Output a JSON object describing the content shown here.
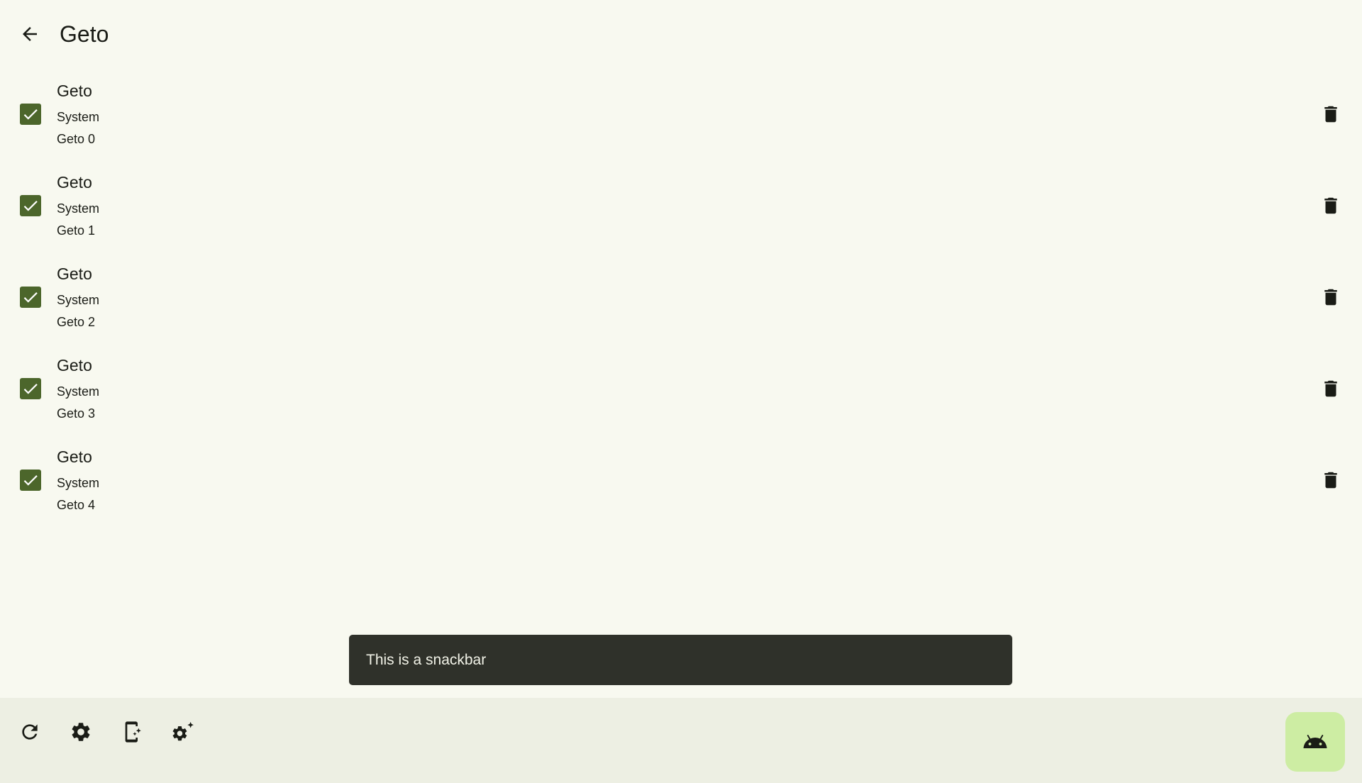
{
  "app": {
    "title": "Geto"
  },
  "topbar": {
    "back_icon": "arrow-back-icon"
  },
  "items": [
    {
      "title": "Geto",
      "subtitle": "System",
      "value": "Geto 0",
      "checked": true
    },
    {
      "title": "Geto",
      "subtitle": "System",
      "value": "Geto 1",
      "checked": true
    },
    {
      "title": "Geto",
      "subtitle": "System",
      "value": "Geto 2",
      "checked": true
    },
    {
      "title": "Geto",
      "subtitle": "System",
      "value": "Geto 3",
      "checked": true
    },
    {
      "title": "Geto",
      "subtitle": "System",
      "value": "Geto 4",
      "checked": true
    }
  ],
  "snackbar": {
    "message": "This is a snackbar"
  },
  "bottombar": {
    "actions": [
      "refresh-icon",
      "settings-icon",
      "app-settings-icon",
      "auto-settings-icon"
    ],
    "fab_icon": "android-icon"
  },
  "colors": {
    "background": "#f8f9f0",
    "checkbox": "#4c662b",
    "snackbar": "#2f312a",
    "bottombar": "#edefe3",
    "fab": "#cdeda3"
  }
}
